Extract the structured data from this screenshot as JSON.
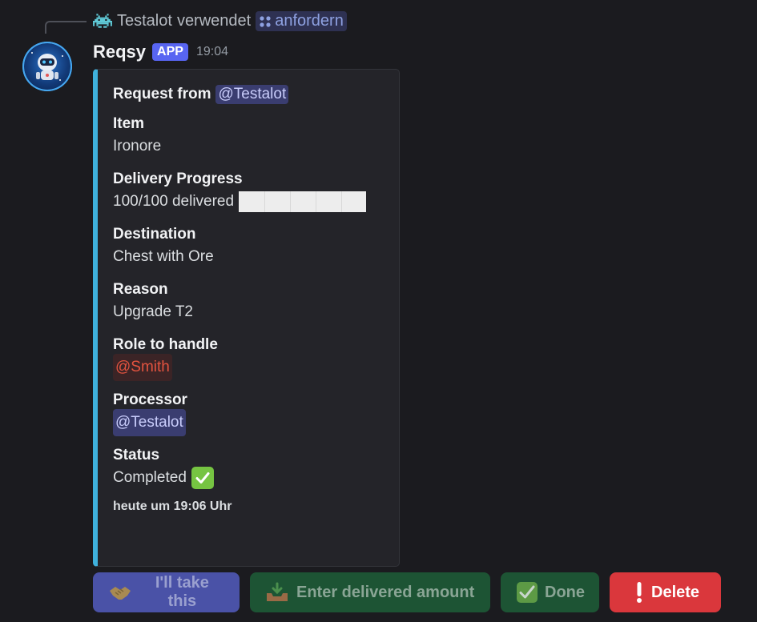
{
  "reply": {
    "user": "Testalot",
    "action": "verwendet",
    "command": "anfordern",
    "user_icon": "space-invader-icon",
    "command_icon": "app-command-icon"
  },
  "message": {
    "author": "Reqsy",
    "badge": "APP",
    "time": "19:04",
    "avatar_icon": "robot-avatar"
  },
  "embed": {
    "accent_color": "#3fb1dc",
    "author_prefix": "Request from",
    "author_mention": "@Testalot",
    "fields": {
      "item": {
        "name": "Item",
        "value": "Ironore"
      },
      "progress": {
        "name": "Delivery Progress",
        "value": "100/100 delivered",
        "fraction": 1.0
      },
      "destination": {
        "name": "Destination",
        "value": "Chest with Ore"
      },
      "reason": {
        "name": "Reason",
        "value": "Upgrade T2"
      },
      "role": {
        "name": "Role to handle",
        "value": "@Smith",
        "color": "#e3533f"
      },
      "processor": {
        "name": "Processor",
        "value": "@Testalot"
      },
      "status": {
        "name": "Status",
        "value": "Completed",
        "icon": "check-mark-icon"
      }
    },
    "footer": "heute um 19:06 Uhr"
  },
  "buttons": {
    "take": {
      "label": "I'll take this",
      "icon": "handshake-icon",
      "color": "#4a52a7"
    },
    "enter": {
      "label": "Enter delivered amount",
      "icon": "inbox-tray-icon",
      "color": "#1d5434"
    },
    "done": {
      "label": "Done",
      "icon": "check-mark-icon",
      "color": "#1d5434"
    },
    "delete": {
      "label": "Delete",
      "icon": "exclamation-icon",
      "color": "#da373c"
    }
  }
}
